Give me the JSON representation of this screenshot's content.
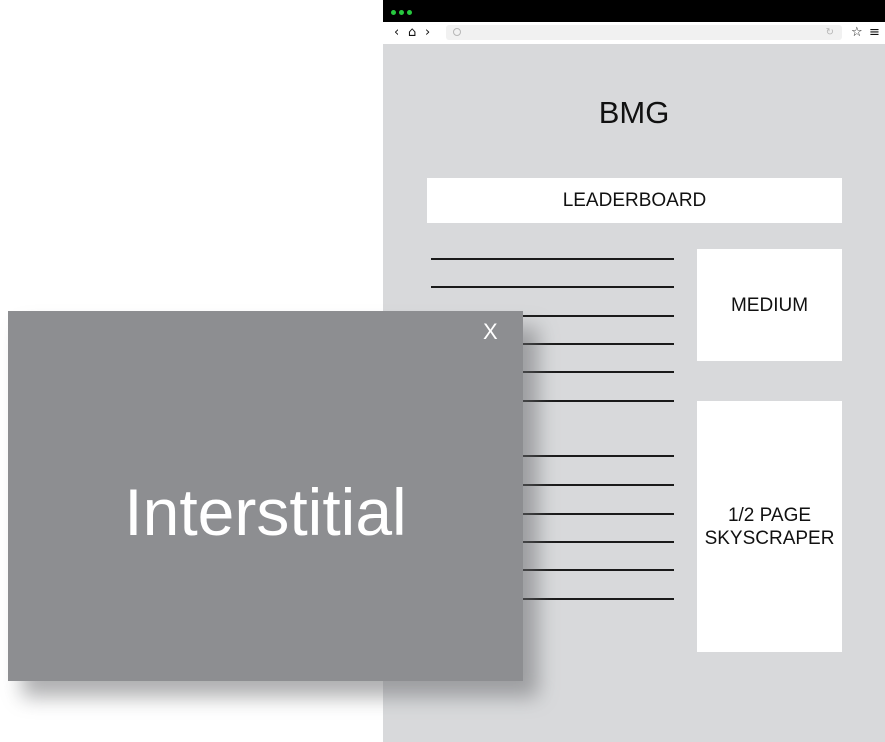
{
  "browser": {
    "back_icon": "‹",
    "home_icon": "⌂",
    "forward_icon": "›",
    "reload_icon": "↻",
    "star_icon": "☆",
    "menu_icon": "≡",
    "address_value": ""
  },
  "page": {
    "brand": "BMG",
    "leaderboard_label": "LEADERBOARD",
    "medium_label": "MEDIUM",
    "skyscraper_label_line1": "1/2 PAGE",
    "skyscraper_label_line2": "SKYSCRAPER"
  },
  "interstitial": {
    "title": "Interstitial",
    "close_label": "X"
  },
  "colors": {
    "page_background": "#d8d9db",
    "overlay_background": "#8d8e91",
    "traffic_light": "#27c93f"
  }
}
